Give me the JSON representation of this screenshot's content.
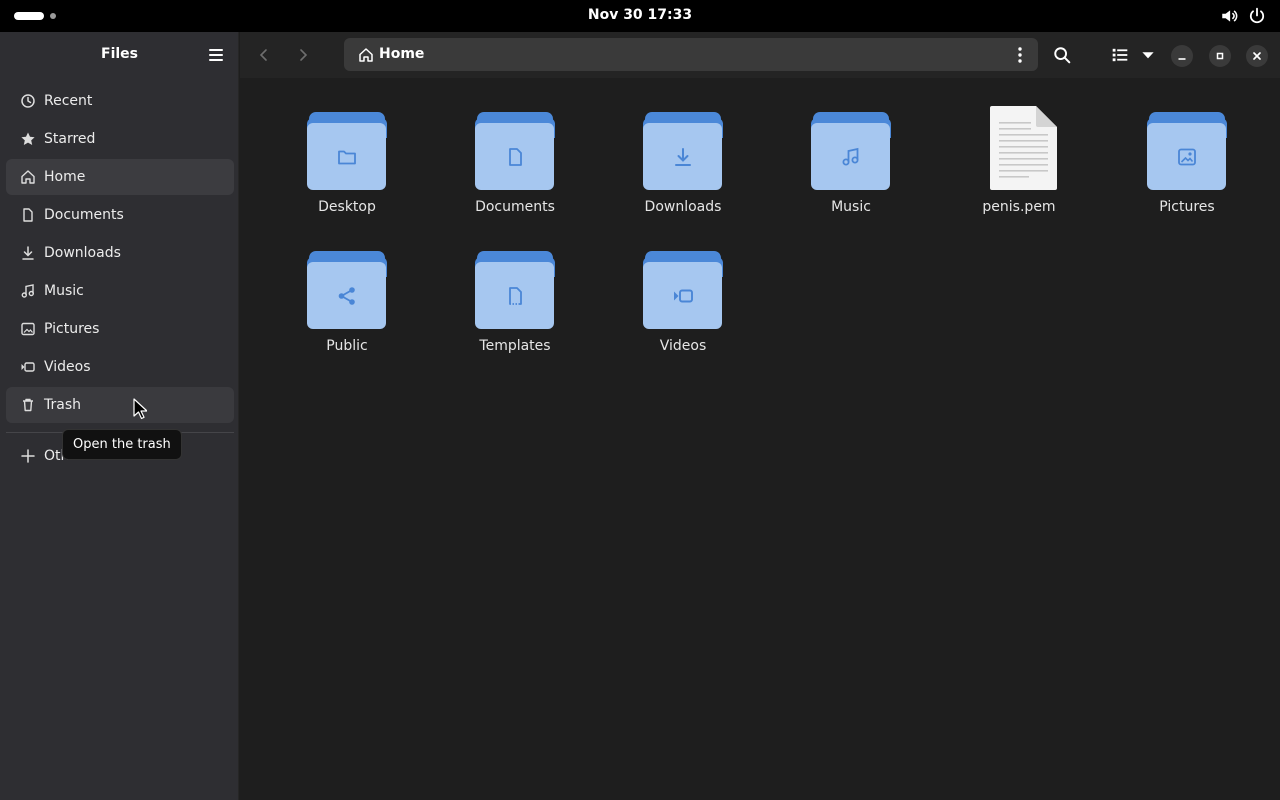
{
  "topbar": {
    "clock": "Nov 30  17:33",
    "volume_icon": "volume-icon",
    "power_icon": "power-icon"
  },
  "sidebar": {
    "title": "Files",
    "items": [
      {
        "label": "Recent",
        "icon": "clock-icon"
      },
      {
        "label": "Starred",
        "icon": "star-icon"
      },
      {
        "label": "Home",
        "icon": "home-icon",
        "active": true
      },
      {
        "label": "Documents",
        "icon": "document-icon"
      },
      {
        "label": "Downloads",
        "icon": "download-icon"
      },
      {
        "label": "Music",
        "icon": "music-icon"
      },
      {
        "label": "Pictures",
        "icon": "picture-icon"
      },
      {
        "label": "Videos",
        "icon": "video-icon"
      },
      {
        "label": "Trash",
        "icon": "trash-icon",
        "hover": true
      }
    ],
    "other_locations": "Other Locations"
  },
  "pathbar": {
    "location": "Home"
  },
  "files": [
    {
      "name": "Desktop",
      "kind": "folder",
      "emblem": "desktop-icon"
    },
    {
      "name": "Documents",
      "kind": "folder",
      "emblem": "document-icon"
    },
    {
      "name": "Downloads",
      "kind": "folder",
      "emblem": "download-icon"
    },
    {
      "name": "Music",
      "kind": "folder",
      "emblem": "music-icon"
    },
    {
      "name": "penis.pem",
      "kind": "file",
      "emblem": "text-file-icon"
    },
    {
      "name": "Pictures",
      "kind": "folder",
      "emblem": "picture-icon"
    },
    {
      "name": "Public",
      "kind": "folder",
      "emblem": "share-icon"
    },
    {
      "name": "Templates",
      "kind": "folder",
      "emblem": "template-icon"
    },
    {
      "name": "Videos",
      "kind": "folder",
      "emblem": "video-icon"
    }
  ],
  "tooltip": "Open the trash",
  "colors": {
    "folder_back": "#4b88d8",
    "folder_front": "#a6c7f0",
    "folder_emblem": "#4a86d6",
    "sidebar_bg": "#2e2e32",
    "content_bg": "#1e1e1e"
  }
}
